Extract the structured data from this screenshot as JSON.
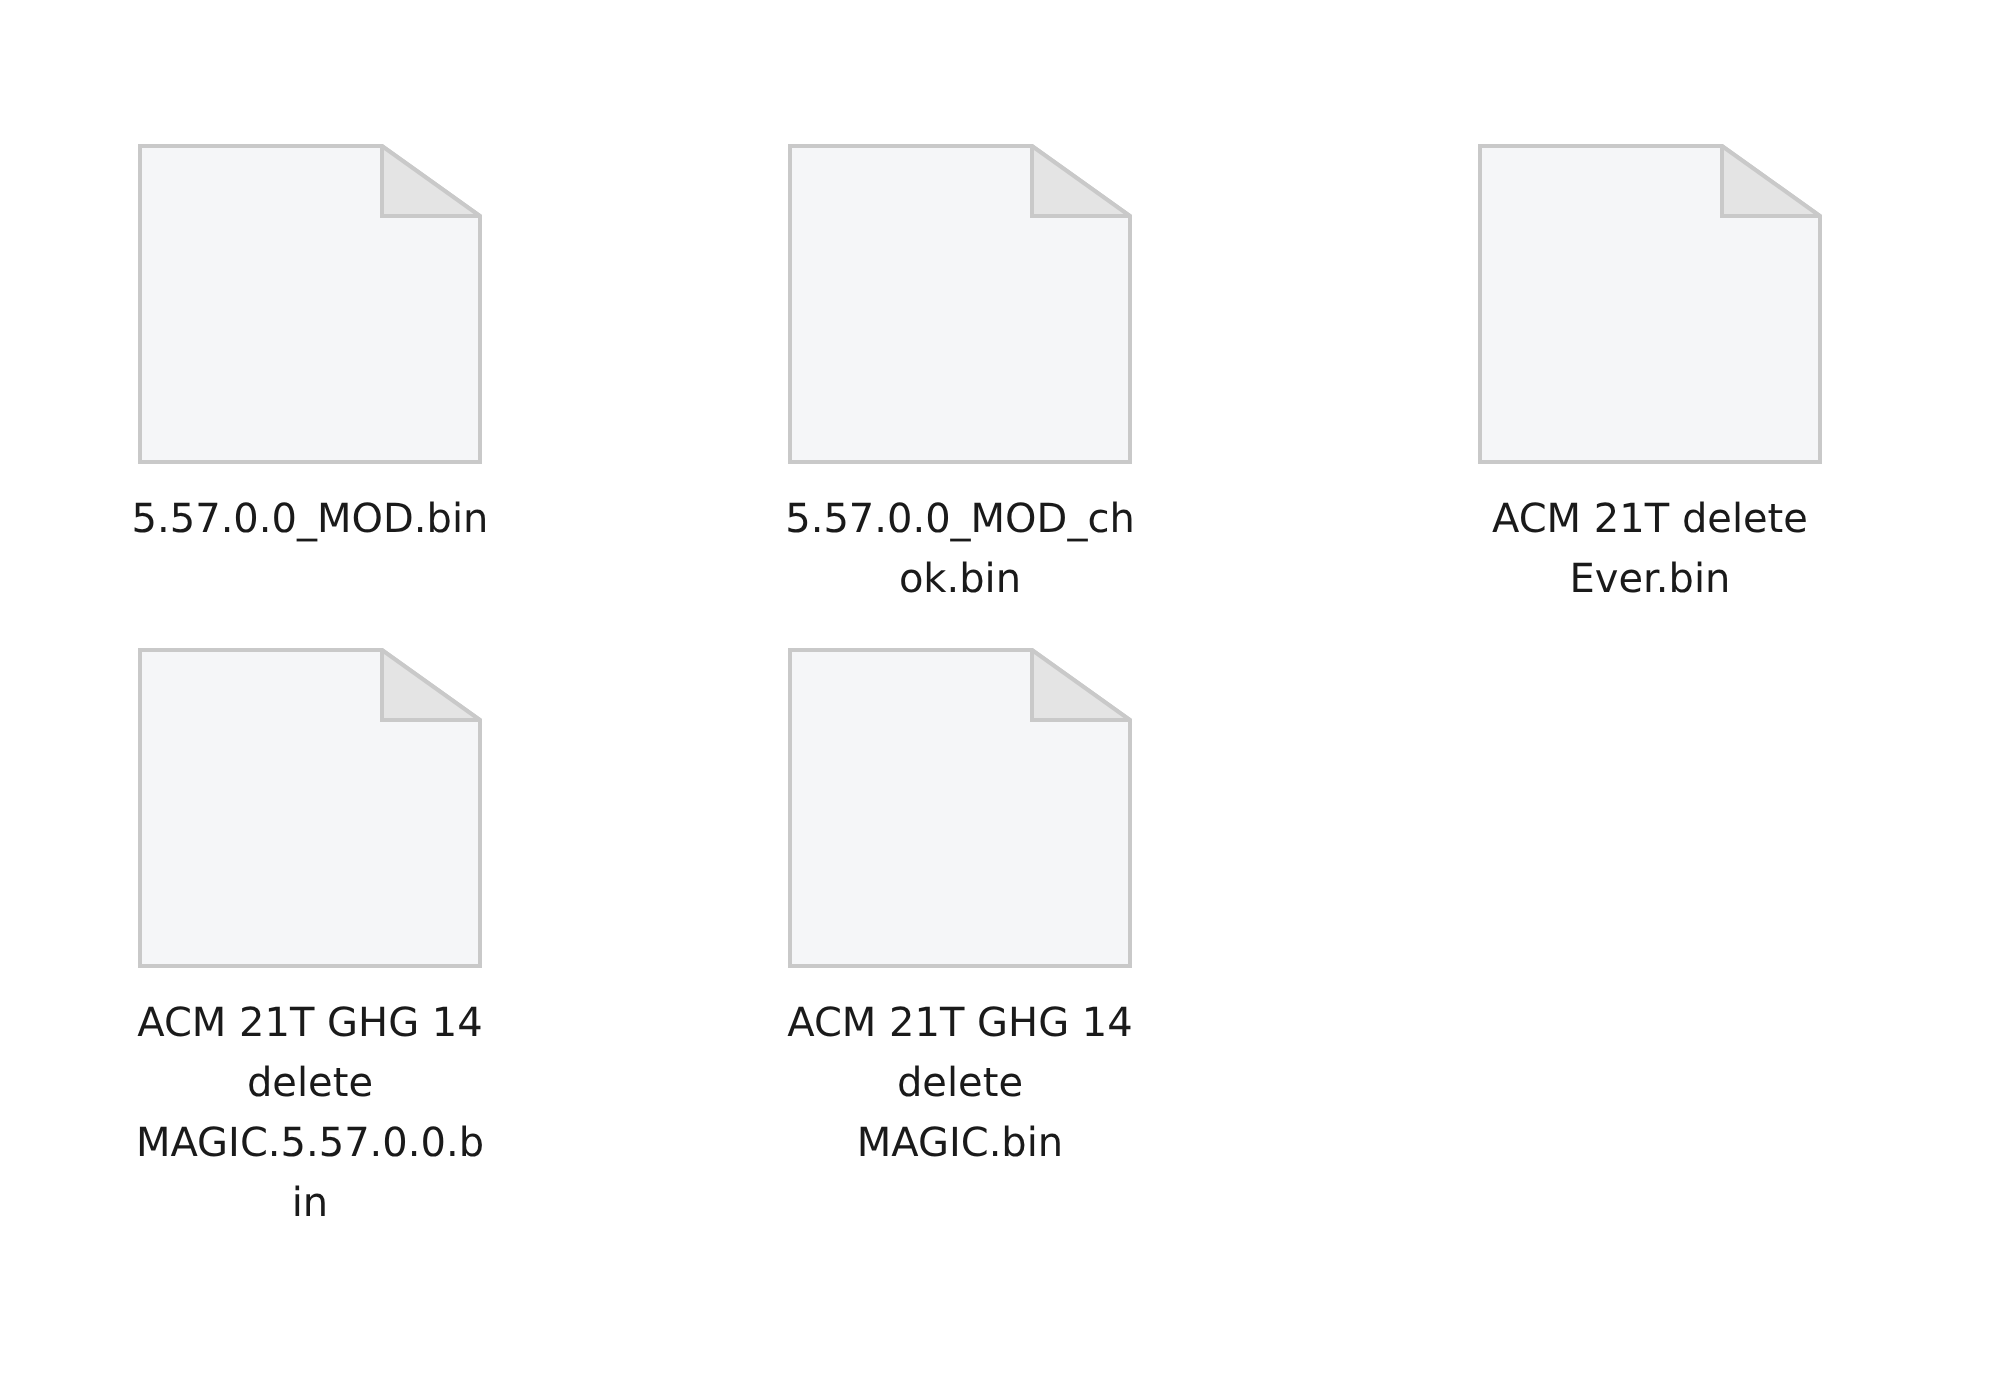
{
  "files": [
    {
      "name_lines": [
        "5.57.0.0_MOD.bin"
      ]
    },
    {
      "name_lines": [
        "5.57.0.0_MOD_ch",
        "ok.bin"
      ]
    },
    {
      "name_lines": [
        "ACM 21T delete",
        "Ever.bin"
      ]
    },
    {
      "name_lines": [
        "ACM 21T GHG 14",
        "delete",
        "MAGIC.5.57.0.0.b",
        "in"
      ]
    },
    {
      "name_lines": [
        "ACM 21T GHG 14",
        "delete",
        "MAGIC.bin"
      ]
    }
  ]
}
